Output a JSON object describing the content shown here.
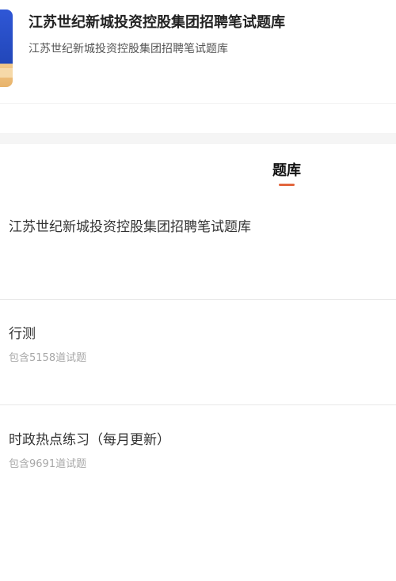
{
  "header": {
    "title": "江苏世纪新城投资控股集团招聘笔试题库",
    "subtitle": "江苏世纪新城投资控股集团招聘笔试题库"
  },
  "tabs": [
    {
      "label": "题库",
      "active": true
    }
  ],
  "bank": {
    "title": "江苏世纪新城投资控股集团招聘笔试题库"
  },
  "items": [
    {
      "title": "行测",
      "count": "包含5158道试题"
    },
    {
      "title": "时政热点练习（每月更新）",
      "count": "包含9691道试题"
    }
  ],
  "colors": {
    "accent": "#e2663e",
    "cover_blue": "#2f57d6"
  }
}
